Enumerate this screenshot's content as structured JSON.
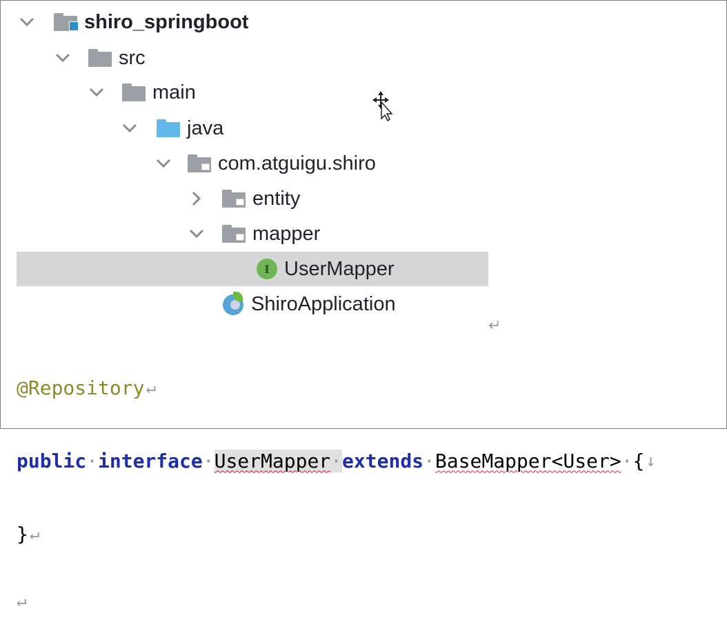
{
  "project_tree": {
    "items": [
      {
        "label": "shiro_springboot",
        "icon": "module-folder-icon",
        "expanded": true
      },
      {
        "label": "src",
        "icon": "folder-icon",
        "expanded": true
      },
      {
        "label": "main",
        "icon": "folder-icon",
        "expanded": true
      },
      {
        "label": "java",
        "icon": "source-folder-icon",
        "expanded": true
      },
      {
        "label": "com.atguigu.shiro",
        "icon": "package-icon",
        "expanded": true
      },
      {
        "label": "entity",
        "icon": "package-icon",
        "expanded": false
      },
      {
        "label": "mapper",
        "icon": "package-icon",
        "expanded": true
      },
      {
        "label": "UserMapper",
        "icon": "interface-icon",
        "selected": true
      },
      {
        "label": "ShiroApplication",
        "icon": "spring-boot-app-icon"
      }
    ]
  },
  "editor": {
    "annotation": "@Repository",
    "kw_public": "public",
    "kw_interface": "interface",
    "interface_name": "UserMapper",
    "kw_extends": "extends",
    "base_type": "BaseMapper<User>",
    "open_brace": "{",
    "close_brace": "}"
  },
  "marks": {
    "paragraph": "↵",
    "space_dot": "·",
    "down_arrow": "↓"
  },
  "colors": {
    "selection": "#d6d6d6",
    "keyword": "#1c2fa8",
    "annotation": "#8a8a2a",
    "interface_badge": "#6fb553",
    "source_folder": "#62b8e8"
  }
}
